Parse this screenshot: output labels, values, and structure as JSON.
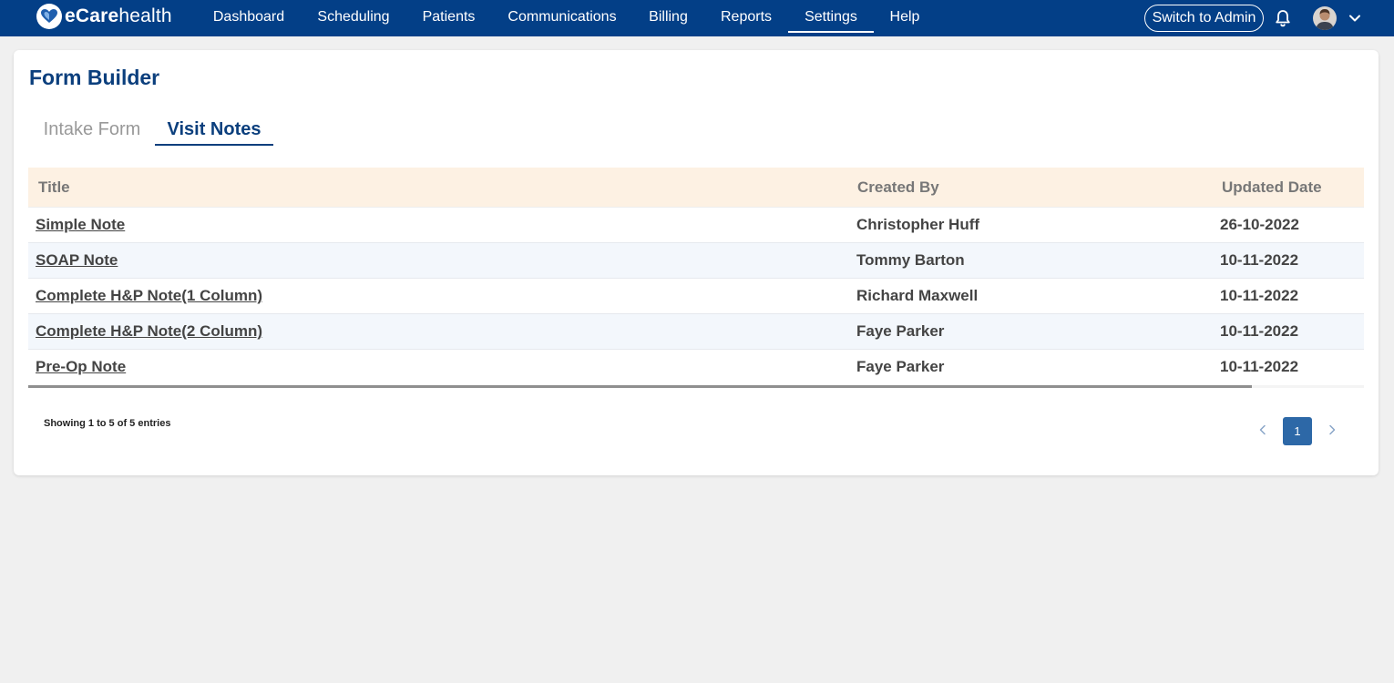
{
  "app": {
    "logo_prefix": "eCare",
    "logo_suffix": "health"
  },
  "nav": {
    "items": [
      {
        "label": "Dashboard"
      },
      {
        "label": "Scheduling"
      },
      {
        "label": "Patients"
      },
      {
        "label": "Communications"
      },
      {
        "label": "Billing"
      },
      {
        "label": "Reports"
      },
      {
        "label": "Settings",
        "active": true
      },
      {
        "label": "Help"
      }
    ],
    "switch_label": "Switch to Admin",
    "icons": {
      "bell": "bell-icon",
      "avatar": "avatar",
      "menu": "chevron-down-icon"
    }
  },
  "page": {
    "title": "Form Builder",
    "tabs": [
      {
        "label": "Intake Form",
        "active": false
      },
      {
        "label": "Visit Notes",
        "active": true
      }
    ]
  },
  "table": {
    "headers": {
      "title": "Title",
      "created_by": "Created By",
      "updated_date": "Updated Date"
    },
    "rows": [
      {
        "title": "Simple Note",
        "created_by": "Christopher Huff",
        "updated_date": "26-10-2022"
      },
      {
        "title": "SOAP Note",
        "created_by": "Tommy Barton",
        "updated_date": "10-11-2022"
      },
      {
        "title": "Complete H&P Note(1 Column)",
        "created_by": "Richard Maxwell",
        "updated_date": "10-11-2022"
      },
      {
        "title": "Complete H&P Note(2 Column)",
        "created_by": "Faye Parker",
        "updated_date": "10-11-2022"
      },
      {
        "title": "Pre-Op Note",
        "created_by": "Faye Parker",
        "updated_date": "10-11-2022"
      }
    ]
  },
  "footer": {
    "showing_prefix": "Showing",
    "from": "1",
    "to_word": "to",
    "to": "5",
    "of_word": "of",
    "total": "5",
    "entries_word": "entries",
    "current_page": "1"
  },
  "colors": {
    "nav_bg": "#033f87",
    "title": "#0b3f7d",
    "header_bg": "#fdf1e3",
    "row_alt": "#f3f7fc",
    "page_active": "#2d68a7"
  }
}
